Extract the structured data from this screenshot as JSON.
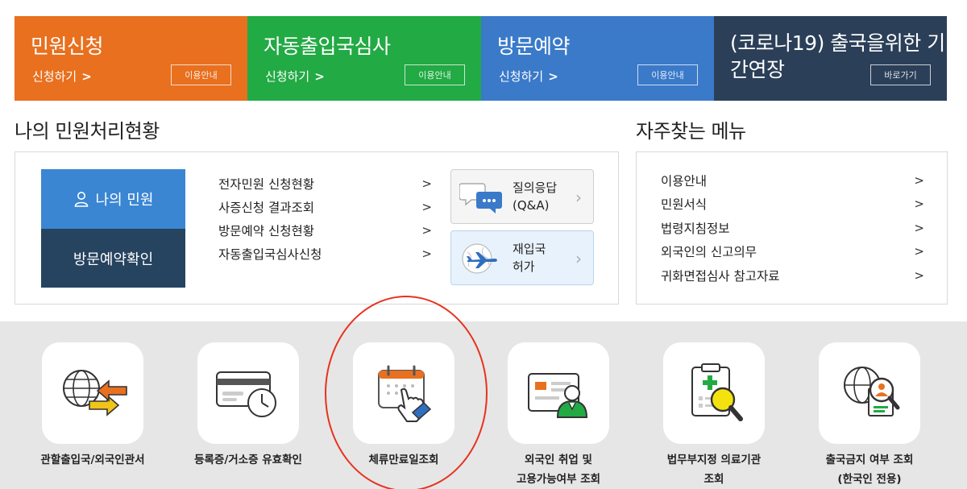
{
  "tiles": [
    {
      "title": "민원신청",
      "link": "신청하기",
      "button": "이용안내",
      "color": "#e8701f"
    },
    {
      "title": "자동출입국심사",
      "link": "신청하기",
      "button": "이용안내",
      "color": "#22aa44"
    },
    {
      "title": "방문예약",
      "link": "신청하기",
      "button": "이용안내",
      "color": "#3a7ac9"
    },
    {
      "title": "(코로나19) 출국을위한 기간연장",
      "link": "",
      "button": "바로가기",
      "color": "#2b3f58"
    }
  ],
  "status": {
    "heading": "나의 민원처리현황",
    "my_civil": "나의 민원",
    "visit_confirm": "방문예약확인",
    "items": [
      "전자민원 신청현황",
      "사증신청 결과조회",
      "방문예약 신청현황",
      "자동출입국심사신청"
    ],
    "qa": {
      "line1": "질의응답",
      "line2": "(Q&A)"
    },
    "reentry": {
      "line1": "재입국",
      "line2": "허가"
    }
  },
  "favorites": {
    "heading": "자주찾는 메뉴",
    "items": [
      "이용안내",
      "민원서식",
      "법령지침정보",
      "외국인의 신고의무",
      "귀화면접심사 참고자료"
    ]
  },
  "services": [
    {
      "label1": "관할출입국/외국인관서",
      "label2": "",
      "icon": "globe-arrows-icon"
    },
    {
      "label1": "등록증/거소증 유효확인",
      "label2": "",
      "icon": "id-card-clock-icon"
    },
    {
      "label1": "체류만료일조회",
      "label2": "",
      "icon": "calendar-hand-icon"
    },
    {
      "label1": "외국인 취업 및",
      "label2": "고용가능여부 조회",
      "icon": "worker-screen-icon"
    },
    {
      "label1": "법무부지정 의료기관",
      "label2": "조회",
      "icon": "medical-clipboard-icon"
    },
    {
      "label1": "출국금지 여부 조회",
      "label2": "(한국인 전용)",
      "icon": "globe-search-icon"
    }
  ],
  "chevron": "›",
  "colors": {
    "highlight_circle": "#e8321e",
    "services_bg": "#e6e6e6"
  }
}
